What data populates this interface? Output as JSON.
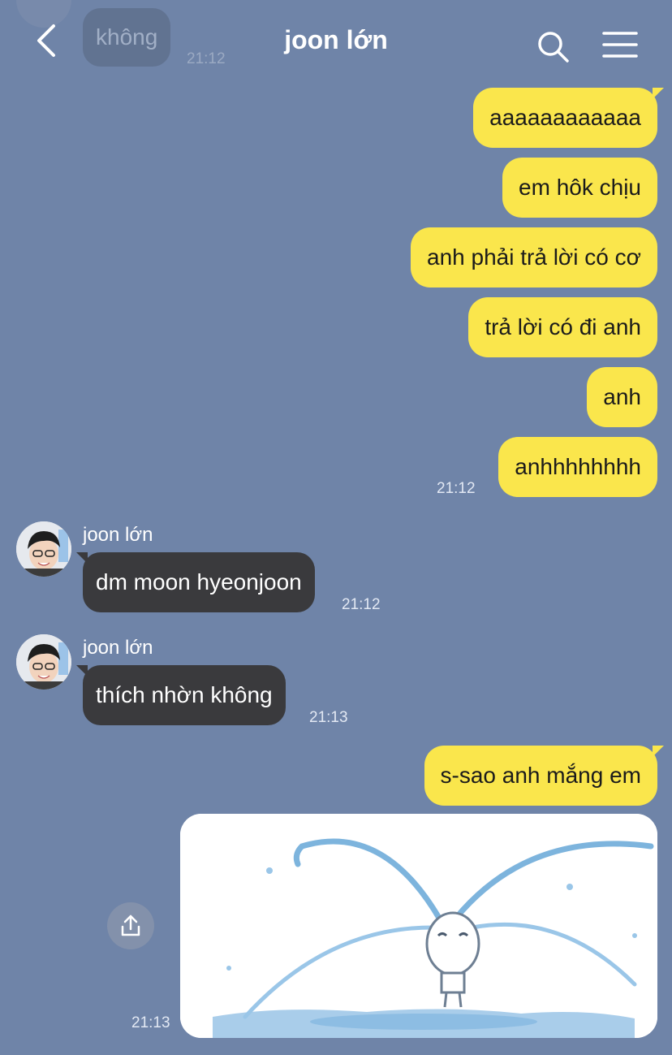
{
  "header": {
    "title": "joon lớn",
    "back_icon": "chevron-left-icon",
    "search_icon": "search-icon",
    "menu_icon": "hamburger-menu-icon"
  },
  "scrolled_message": {
    "text": "không",
    "time": "21:12"
  },
  "outgoing_group_1": {
    "messages": [
      "aaaaaaaaaaaa",
      "em hôk chịu",
      "anh phải trả lời có cơ",
      "trả lời có đi anh",
      "anh",
      "anhhhhhhhh"
    ],
    "time": "21:12"
  },
  "incoming_1": {
    "sender": "joon lớn",
    "text": "dm moon hyeonjoon",
    "time": "21:12"
  },
  "incoming_2": {
    "sender": "joon lớn",
    "text": "thích nhờn không",
    "time": "21:13"
  },
  "outgoing_group_2": {
    "messages": [
      "s-sao anh mắng em"
    ],
    "image_description_icon": "crying-character-sticker",
    "share_icon": "share-icon",
    "time": "21:13"
  },
  "colors": {
    "background": "#6f84a8",
    "outgoing_bubble": "#fae64c",
    "incoming_bubble": "#3a3a3d"
  }
}
